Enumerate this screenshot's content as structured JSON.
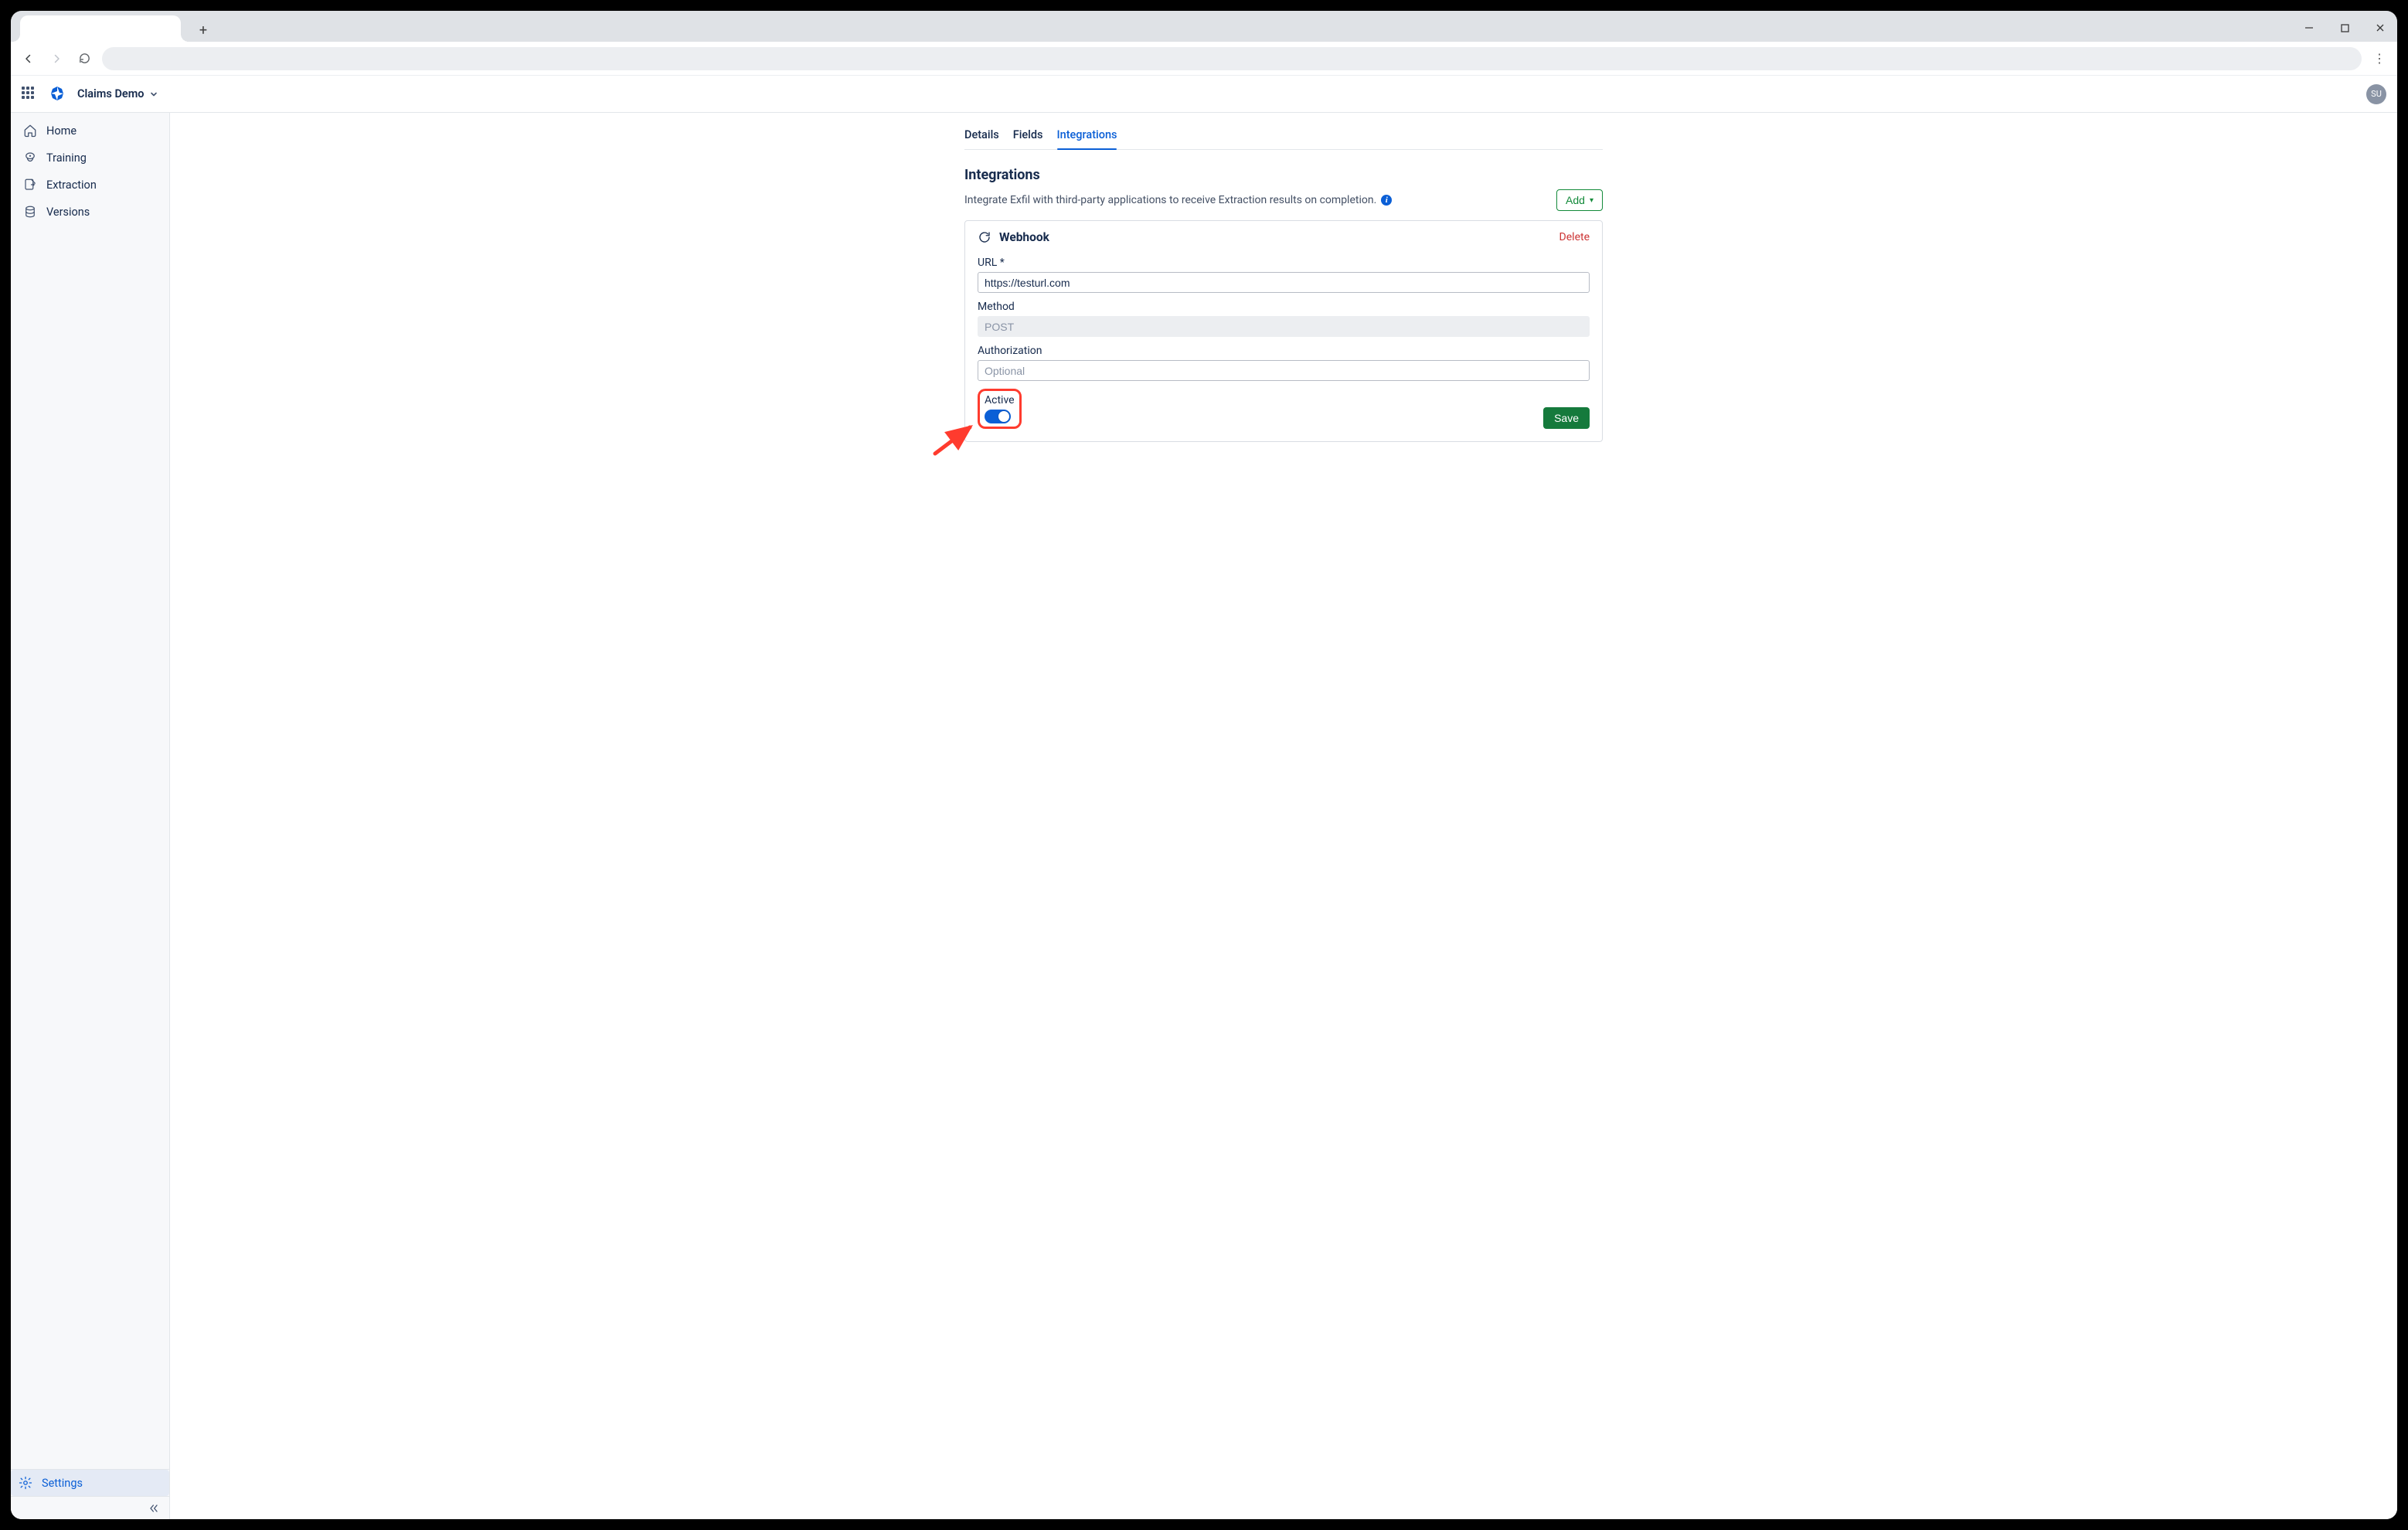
{
  "browser": {
    "new_tab_plus": "+",
    "win_min": "—",
    "win_max": "▢",
    "win_close": "✕",
    "kebab": "⋮"
  },
  "header": {
    "project_name": "Claims Demo",
    "avatar_initials": "SU"
  },
  "sidebar": {
    "items": [
      {
        "label": "Home"
      },
      {
        "label": "Training"
      },
      {
        "label": "Extraction"
      },
      {
        "label": "Versions"
      }
    ],
    "settings_label": "Settings"
  },
  "tabs": [
    {
      "label": "Details",
      "active": false
    },
    {
      "label": "Fields",
      "active": false
    },
    {
      "label": "Integrations",
      "active": true
    }
  ],
  "section": {
    "title": "Integrations",
    "description": "Integrate Exfil with third-party applications to receive Extraction results on completion.",
    "add_label": "Add"
  },
  "webhook": {
    "title": "Webhook",
    "delete_label": "Delete",
    "fields": {
      "url_label": "URL",
      "url_required_marker": "*",
      "url_value": "https://testurl.com",
      "method_label": "Method",
      "method_value": "POST",
      "auth_label": "Authorization",
      "auth_placeholder": "Optional",
      "active_label": "Active"
    },
    "save_label": "Save"
  }
}
